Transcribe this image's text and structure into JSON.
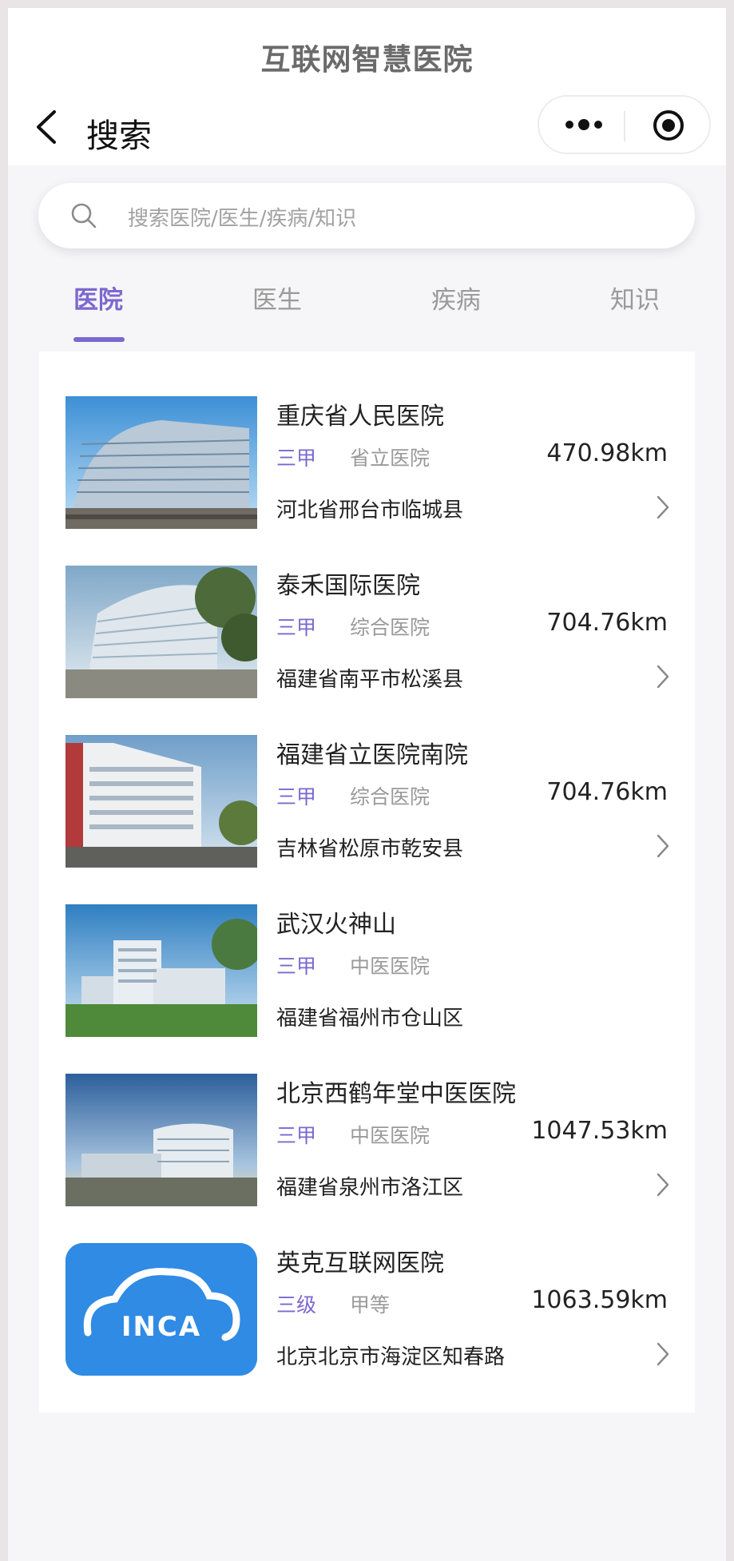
{
  "app": {
    "title": "互联网智慧医院"
  },
  "nav": {
    "title": "搜索"
  },
  "search": {
    "placeholder": "搜索医院/医生/疾病/知识"
  },
  "tabs": [
    {
      "label": "医院",
      "active": true
    },
    {
      "label": "医生",
      "active": false
    },
    {
      "label": "疾病",
      "active": false
    },
    {
      "label": "知识",
      "active": false
    }
  ],
  "colors": {
    "accent": "#7b68d0",
    "background": "#f6f6f8"
  },
  "hospitals": [
    {
      "name": "重庆省人民医院",
      "grade": "三甲",
      "type": "省立医院",
      "distance": "470.98km",
      "address": "河北省邢台市临城县",
      "image": "hospital-building-photo"
    },
    {
      "name": "泰禾国际医院",
      "grade": "三甲",
      "type": "综合医院",
      "distance": "704.76km",
      "address": "福建省南平市松溪县",
      "image": "hospital-building-photo"
    },
    {
      "name": "福建省立医院南院",
      "grade": "三甲",
      "type": "综合医院",
      "distance": "704.76km",
      "address": "吉林省松原市乾安县",
      "image": "hospital-building-photo"
    },
    {
      "name": "武汉火神山",
      "grade": "三甲",
      "type": "中医医院",
      "distance": "",
      "address": "福建省福州市仓山区",
      "image": "hospital-building-photo"
    },
    {
      "name": "北京西鹤年堂中医医院",
      "grade": "三甲",
      "type": "中医医院",
      "distance": "1047.53km",
      "address": "福建省泉州市洛江区",
      "image": "hospital-building-photo"
    },
    {
      "name": "英克互联网医院",
      "grade": "三级",
      "type": "甲等",
      "distance": "1063.59km",
      "address": "北京北京市海淀区知春路",
      "image": "inca-logo",
      "logo_text": "INCA"
    }
  ]
}
